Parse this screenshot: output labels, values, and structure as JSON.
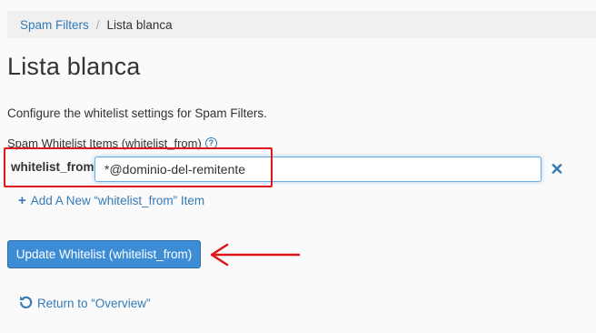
{
  "breadcrumb": {
    "parent": "Spam Filters",
    "separator": "/",
    "current": "Lista blanca"
  },
  "page": {
    "title": "Lista blanca",
    "intro": "Configure the whitelist settings for Spam Filters."
  },
  "whitelist": {
    "section_label": "Spam Whitelist Items (whitelist_from)",
    "help_icon": "?",
    "field_label": "whitelist_from",
    "input_value": "*@dominio-del-remitente",
    "remove_icon": "✕",
    "add_link_label": "Add A New “whitelist_from” Item",
    "submit_label": "Update Whitelist (whitelist_from)"
  },
  "footer": {
    "return_label": "Return to “Overview”"
  },
  "colors": {
    "link": "#337ab7",
    "primary_button": "#3d8cd6",
    "annotation": "#e0141b"
  },
  "icons": [
    "help-icon",
    "remove-icon",
    "plus-icon",
    "return-icon",
    "annotation-arrow"
  ]
}
